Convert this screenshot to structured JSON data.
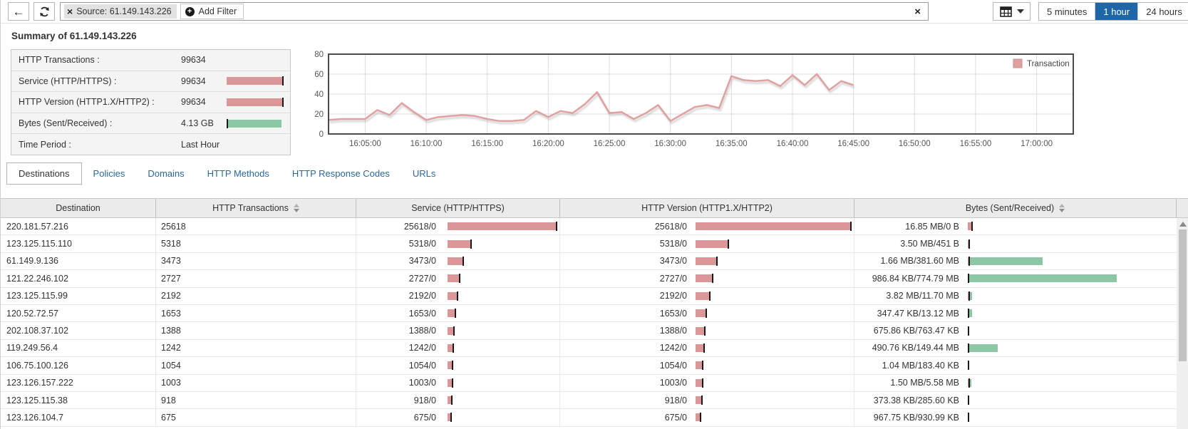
{
  "toolbar": {
    "back_icon": "left-arrow",
    "refresh_icon": "circular-arrows",
    "filter": {
      "remove_icon": "x",
      "label": "Source: 61.149.143.226",
      "add_filter_label": "Add Filter",
      "clear_icon": "x"
    },
    "view_toggle": {
      "icon": "table-grid",
      "caret": "down"
    },
    "time_buttons": [
      {
        "label": "5 minutes",
        "selected": false
      },
      {
        "label": "1 hour",
        "selected": true
      },
      {
        "label": "24 hours",
        "selected": false
      }
    ]
  },
  "colors": {
    "accent_blue": "#1f66a8",
    "link_blue": "#2767a5",
    "bar_pink": "#db9797",
    "bar_green": "#8dc8a6",
    "tick_black": "#1a1a1a",
    "chart_line": "#e0a1a1",
    "header_bg": "#ebebeb"
  },
  "summary": {
    "title": "Summary of 61.149.143.226",
    "rows": [
      {
        "label": "HTTP Transactions :",
        "value": "99634",
        "bar": "none"
      },
      {
        "label": "Service (HTTP/HTTPS) :",
        "value": "99634",
        "bar": "pink"
      },
      {
        "label": "HTTP Version (HTTP1.X/HTTP2) :",
        "value": "99634",
        "bar": "pink"
      },
      {
        "label": "Bytes (Sent/Received) :",
        "value": "4.13 GB",
        "bar": "green"
      },
      {
        "label": "Time Period :",
        "value": "Last Hour",
        "bar": "none"
      }
    ]
  },
  "chart_data": {
    "type": "line",
    "title": "",
    "legend": [
      "Transaction"
    ],
    "legend_position": "top-right",
    "grid": true,
    "ylim": [
      0,
      80
    ],
    "yticks": [
      0,
      20,
      40,
      60,
      80
    ],
    "xtick_minutes": [
      5,
      10,
      15,
      20,
      25,
      30,
      35,
      40,
      45,
      50,
      55,
      60
    ],
    "xtick_labels": [
      "16:05:00",
      "16:10:00",
      "16:15:00",
      "16:20:00",
      "16:25:00",
      "16:30:00",
      "16:35:00",
      "16:40:00",
      "16:45:00",
      "16:50:00",
      "16:55:00",
      "17:00:00"
    ],
    "x_domain_minutes": [
      2,
      63
    ],
    "series": [
      {
        "name": "Transaction",
        "x_minutes": [
          2,
          3,
          4,
          5,
          6,
          7,
          8,
          9,
          10,
          11,
          12,
          13,
          14,
          15,
          16,
          17,
          18,
          19,
          20,
          21,
          22,
          23,
          24,
          25,
          26,
          27,
          28,
          29,
          30,
          31,
          32,
          33,
          34,
          35,
          36,
          37,
          38,
          39,
          40,
          41,
          42,
          43,
          44,
          45
        ],
        "values": [
          14,
          15,
          15,
          15,
          24,
          19,
          31,
          22,
          14,
          17,
          18,
          19,
          18,
          15,
          13,
          13,
          14,
          23,
          17,
          23,
          21,
          30,
          42,
          21,
          22,
          15,
          21,
          29,
          13,
          20,
          27,
          29,
          26,
          58,
          54,
          53,
          54,
          48,
          59,
          49,
          60,
          44,
          53,
          49
        ]
      }
    ]
  },
  "tabs": [
    {
      "label": "Destinations",
      "active": true
    },
    {
      "label": "Policies",
      "active": false
    },
    {
      "label": "Domains",
      "active": false
    },
    {
      "label": "HTTP Methods",
      "active": false
    },
    {
      "label": "HTTP Response Codes",
      "active": false
    },
    {
      "label": "URLs",
      "active": false
    }
  ],
  "table": {
    "columns": [
      {
        "label": "Destination",
        "sortable": false
      },
      {
        "label": "HTTP Transactions",
        "sortable": true
      },
      {
        "label": "Service (HTTP/HTTPS)",
        "sortable": false
      },
      {
        "label": "HTTP Version (HTTP1.X/HTTP2)",
        "sortable": false
      },
      {
        "label": "Bytes (Sent/Received)",
        "sortable": true
      }
    ],
    "max_transactions": 25618,
    "max_bytes_mb": 774.79,
    "rows": [
      {
        "destination": "220.181.57.216",
        "transactions": 25618,
        "service": "25618/0",
        "http_version": "25618/0",
        "bytes": "16.85 MB/0 B",
        "sent_mb": 16.85,
        "recv_mb": 0
      },
      {
        "destination": "123.125.115.110",
        "transactions": 5318,
        "service": "5318/0",
        "http_version": "5318/0",
        "bytes": "3.50 MB/451 B",
        "sent_mb": 3.5,
        "recv_mb": 0.00045
      },
      {
        "destination": "61.149.9.136",
        "transactions": 3473,
        "service": "3473/0",
        "http_version": "3473/0",
        "bytes": "1.66 MB/381.60 MB",
        "sent_mb": 1.66,
        "recv_mb": 381.6
      },
      {
        "destination": "121.22.246.102",
        "transactions": 2727,
        "service": "2727/0",
        "http_version": "2727/0",
        "bytes": "986.84 KB/774.79 MB",
        "sent_mb": 0.96,
        "recv_mb": 774.79
      },
      {
        "destination": "123.125.115.99",
        "transactions": 2192,
        "service": "2192/0",
        "http_version": "2192/0",
        "bytes": "3.82 MB/11.70 MB",
        "sent_mb": 3.82,
        "recv_mb": 11.7
      },
      {
        "destination": "120.52.72.57",
        "transactions": 1653,
        "service": "1653/0",
        "http_version": "1653/0",
        "bytes": "347.47 KB/13.12 MB",
        "sent_mb": 0.34,
        "recv_mb": 13.12
      },
      {
        "destination": "202.108.37.102",
        "transactions": 1388,
        "service": "1388/0",
        "http_version": "1388/0",
        "bytes": "675.86 KB/763.47 KB",
        "sent_mb": 0.66,
        "recv_mb": 0.75
      },
      {
        "destination": "119.249.56.4",
        "transactions": 1242,
        "service": "1242/0",
        "http_version": "1242/0",
        "bytes": "490.76 KB/149.44 MB",
        "sent_mb": 0.48,
        "recv_mb": 149.44
      },
      {
        "destination": "106.75.100.126",
        "transactions": 1054,
        "service": "1054/0",
        "http_version": "1054/0",
        "bytes": "1.04 MB/183.40 KB",
        "sent_mb": 1.04,
        "recv_mb": 0.18
      },
      {
        "destination": "123.126.157.222",
        "transactions": 1003,
        "service": "1003/0",
        "http_version": "1003/0",
        "bytes": "1.50 MB/5.58 MB",
        "sent_mb": 1.5,
        "recv_mb": 5.58
      },
      {
        "destination": "123.125.115.38",
        "transactions": 918,
        "service": "918/0",
        "http_version": "918/0",
        "bytes": "373.38 KB/285.60 KB",
        "sent_mb": 0.36,
        "recv_mb": 0.28
      },
      {
        "destination": "123.126.104.7",
        "transactions": 675,
        "service": "675/0",
        "http_version": "675/0",
        "bytes": "967.75 KB/930.99 KB",
        "sent_mb": 0.95,
        "recv_mb": 0.91
      }
    ]
  }
}
